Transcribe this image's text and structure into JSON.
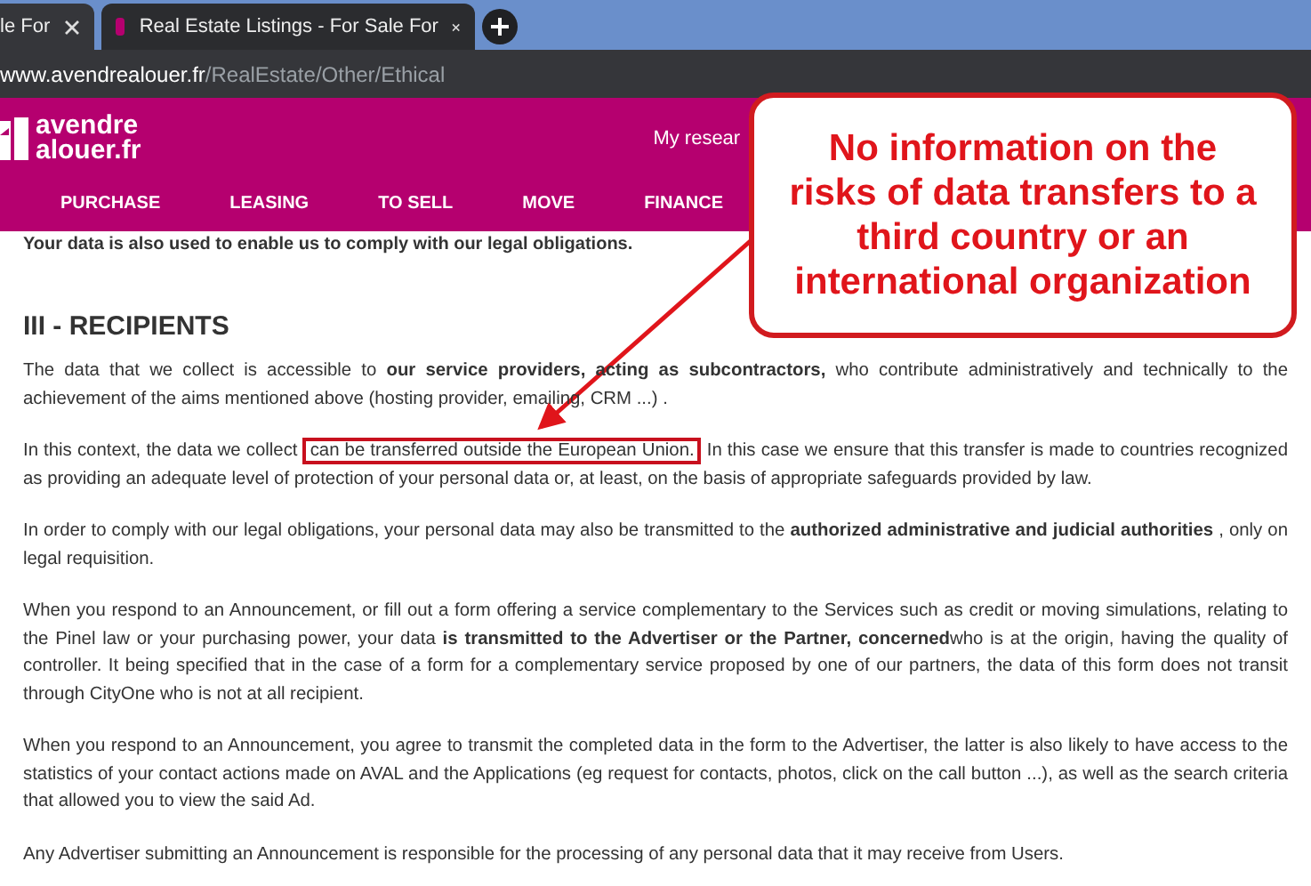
{
  "browser": {
    "tabs": [
      {
        "title": "le For",
        "selected": false
      },
      {
        "title": "Real Estate Listings - For Sale For",
        "selected": true
      }
    ],
    "address": {
      "domain": "www.avendrealouer.fr",
      "path": "/RealEstate/Other/Ethical"
    }
  },
  "site": {
    "logo": [
      "avendre",
      "alouer.fr"
    ],
    "header_link": "My resear",
    "nav": [
      "PURCHASE",
      "LEASING",
      "TO SELL",
      "MOVE",
      "FINANCE"
    ]
  },
  "content": {
    "cut_line": "Your data is also used to enable us to comply with our legal obligations.",
    "heading": "III - RECIPIENTS",
    "paragraphs": [
      {
        "kind": "plain",
        "text": "The data that we collect is accessible to **our service providers, acting as subcontractors,** who contribute administratively and technically to the achievement of the aims mentioned above (hosting provider, emailing, CRM ...) ."
      },
      {
        "kind": "highlighted",
        "before": "In this context, the data we collect",
        "highlight": "can be transferred outside the European Union.",
        "after": "In this case we ensure that this transfer is made to countries recognized as providing an adequate level of protection of your personal data or, at least, on the basis of appropriate safeguards provided by law."
      },
      {
        "kind": "plain",
        "text": "In order to comply with our legal obligations, your personal data may also be transmitted to the **authorized administrative and judicial authorities** , only on legal requisition."
      },
      {
        "kind": "plain",
        "text": "When you respond to an Announcement, or fill out a form offering a service complementary to the Services such as credit or moving simulations, relating to the Pinel law or your purchasing power, your data **is transmitted to the Advertiser or the Partner, concerned**who is at the origin, having the quality of controller. It being specified that in the case of a form for a complementary service proposed by one of our partners, the data of this form does not transit through CityOne who is not at all recipient."
      },
      {
        "kind": "plain",
        "text": "When you respond to an Announcement, you agree to transmit the completed data in the form to the Advertiser, the latter is also likely to have access to the statistics of your contact actions made on AVAL and the Applications (eg request for contacts, photos, click on the call button ...), as well as the search criteria that allowed you to view the said Ad."
      },
      {
        "kind": "plain",
        "text": "Any Advertiser submitting an Announcement is responsible for the processing of any personal data that it may receive from Users."
      }
    ]
  },
  "callout": {
    "text": "No information on the risks of data transfers to a third country or an international organization"
  }
}
